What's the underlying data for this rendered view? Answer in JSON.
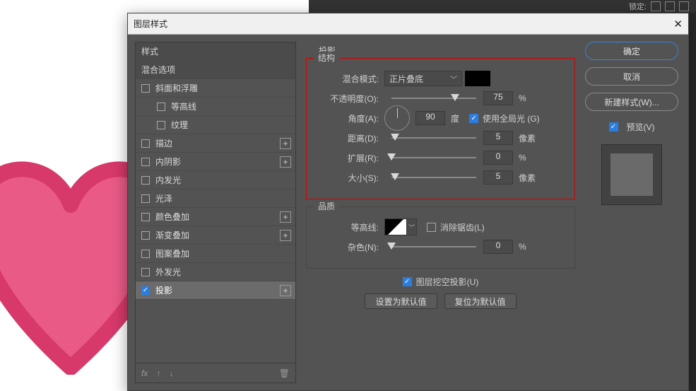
{
  "dialog": {
    "title": "图层样式",
    "close_glyph": "✕"
  },
  "styles": {
    "header_styles": "样式",
    "header_blend": "混合选项",
    "bevel": "斜面和浮雕",
    "contour": "等高线",
    "texture": "纹理",
    "stroke": "描边",
    "inner_shadow": "内阴影",
    "inner_glow": "内发光",
    "satin": "光泽",
    "color_overlay": "颜色叠加",
    "gradient_overlay": "渐变叠加",
    "pattern_overlay": "图案叠加",
    "outer_glow": "外发光",
    "drop_shadow": "投影",
    "footer_fx": "fx",
    "footer_up": "↑",
    "footer_down": "↓",
    "trash_glyph": "🗑"
  },
  "panel": {
    "title": "投影",
    "structure": "结构",
    "blend_mode_label": "混合模式:",
    "blend_mode_value": "正片叠底",
    "opacity_label": "不透明度(O):",
    "opacity_value": "75",
    "percent": "%",
    "angle_label": "角度(A):",
    "angle_value": "90",
    "degree": "度",
    "global_light": "使用全局光 (G)",
    "distance_label": "距离(D):",
    "distance_value": "5",
    "px": "像素",
    "spread_label": "扩展(R):",
    "spread_value": "0",
    "size_label": "大小(S):",
    "size_value": "5",
    "quality": "品质",
    "contour_label": "等高线:",
    "antialias": "消除锯齿(L)",
    "noise_label": "杂色(N):",
    "noise_value": "0",
    "knockout": "图层挖空投影(U)",
    "set_default": "设置为默认值",
    "reset_default": "复位为默认值"
  },
  "buttons": {
    "ok": "确定",
    "cancel": "取消",
    "new_style": "新建样式(W)...",
    "preview": "预览(V)"
  },
  "toolbar": {
    "lock": "锁定:"
  }
}
